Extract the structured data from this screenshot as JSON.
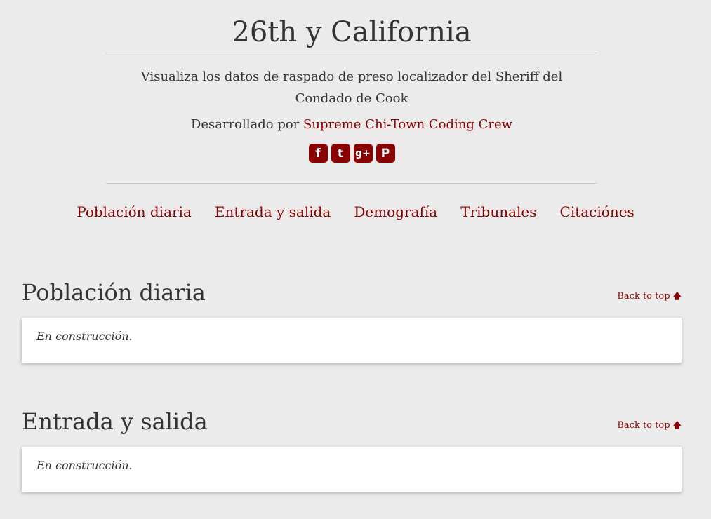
{
  "site": {
    "title": "26th y California",
    "tagline": "Visualiza los datos de raspado de preso localizador del Sheriff del Condado de Cook",
    "credit_prefix": "Desarrollado por ",
    "credit_link": "Supreme Chi-Town Coding Crew"
  },
  "social": [
    {
      "icon": "facebook-icon",
      "glyph": "f"
    },
    {
      "icon": "twitter-icon",
      "glyph": "t"
    },
    {
      "icon": "google-plus-icon",
      "glyph": "g+"
    },
    {
      "icon": "pinterest-icon",
      "glyph": "P"
    }
  ],
  "nav": {
    "items": [
      {
        "label": "Población diaria"
      },
      {
        "label": "Entrada y salida"
      },
      {
        "label": "Demografía"
      },
      {
        "label": "Tribunales"
      },
      {
        "label": "Citaciónes"
      }
    ]
  },
  "sections": [
    {
      "title": "Población diaria",
      "back_to_top": "Back to top",
      "back_icon": "arrow-up-icon",
      "body": "En construcción."
    },
    {
      "title": "Entrada y salida",
      "back_to_top": "Back to top",
      "back_icon": "arrow-up-icon",
      "body": "En construcción."
    }
  ],
  "colors": {
    "accent": "#8b0000",
    "background": "#ebebeb",
    "text": "#333333",
    "card": "#ffffff"
  }
}
